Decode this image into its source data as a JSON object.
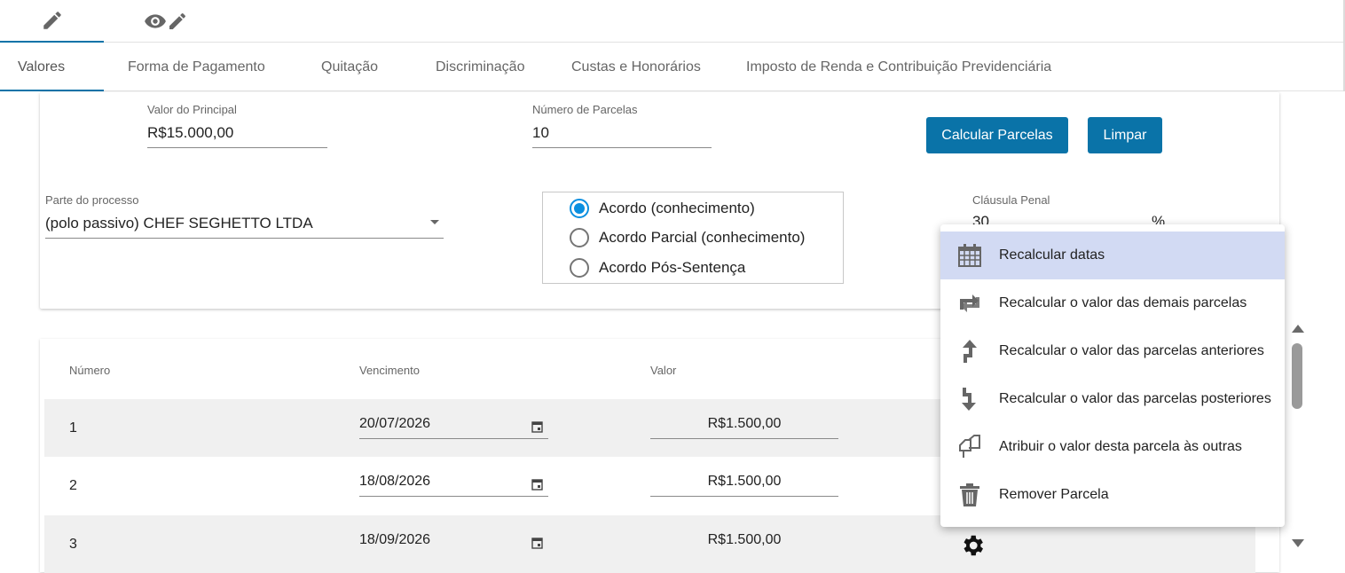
{
  "mode_tabs": [
    {
      "icon": "pencil-icon"
    },
    {
      "icon": "eye-pencil-icon"
    }
  ],
  "sub_tabs": [
    {
      "label": "Valores"
    },
    {
      "label": "Forma de Pagamento"
    },
    {
      "label": "Quitação"
    },
    {
      "label": "Discriminação"
    },
    {
      "label": "Custas e Honorários"
    },
    {
      "label": "Imposto de Renda e Contribuição Previdenciária"
    }
  ],
  "form": {
    "principal_label": "Valor do Principal",
    "principal_value": "R$15.000,00",
    "parcelas_label": "Número de Parcelas",
    "parcelas_value": "10",
    "calc_button": "Calcular Parcelas",
    "clear_button": "Limpar",
    "parte_label": "Parte do processo",
    "parte_value": "(polo passivo) CHEF SEGHETTO LTDA",
    "clausula_label": "Cláusula Penal",
    "clausula_value": "30",
    "clausula_unit": "%",
    "radio_options": [
      {
        "label": "Acordo (conhecimento)",
        "checked": true
      },
      {
        "label": "Acordo Parcial (conhecimento)",
        "checked": false
      },
      {
        "label": "Acordo Pós-Sentença",
        "checked": false
      }
    ]
  },
  "table": {
    "headers": [
      "Número",
      "Vencimento",
      "Valor"
    ],
    "rows": [
      {
        "numero": "1",
        "vencimento": "20/07/2026",
        "valor": "R$1.500,00"
      },
      {
        "numero": "2",
        "vencimento": "18/08/2026",
        "valor": "R$1.500,00"
      },
      {
        "numero": "3",
        "vencimento": "18/09/2026",
        "valor": "R$1.500,00"
      }
    ]
  },
  "context_menu": [
    {
      "icon": "calendar-grid-icon",
      "label": "Recalcular datas"
    },
    {
      "icon": "swap-arrows-icon",
      "label": "Recalcular o valor das demais parcelas"
    },
    {
      "icon": "arrow-up-icon",
      "label": "Recalcular o valor das parcelas anteriores"
    },
    {
      "icon": "arrow-down-icon",
      "label": "Recalcular o valor das parcelas posteriores"
    },
    {
      "icon": "copy-pages-icon",
      "label": "Atribuir o valor desta parcela às outras"
    },
    {
      "icon": "trash-icon",
      "label": "Remover Parcela"
    }
  ],
  "colors": {
    "accent": "#0a73a8",
    "radio": "#0a8fe0",
    "menu_highlight": "#d2daf3"
  }
}
